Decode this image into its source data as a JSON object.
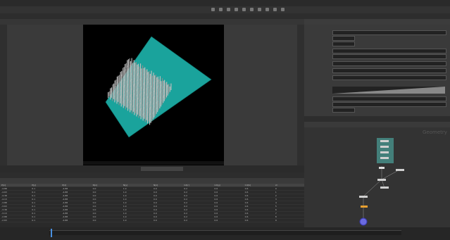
{
  "geometry_spreadsheet": {
    "columns": [
      "P[x]",
      "P[y]",
      "P[z]",
      "N[x]",
      "N[y]",
      "N[z]",
      "Cd[r]",
      "Cd[g]",
      "Cd[b]",
      "id"
    ],
    "rows": [
      [
        "-4.88",
        "0.1",
        "-4.88",
        "0.0",
        "1.0",
        "0.0",
        "0.2",
        "0.6",
        "0.6",
        "0"
      ],
      [
        "-4.63",
        "0.1",
        "-4.88",
        "0.0",
        "1.0",
        "0.0",
        "0.2",
        "0.6",
        "0.6",
        "1"
      ],
      [
        "-4.38",
        "0.1",
        "-4.88",
        "0.0",
        "1.0",
        "0.0",
        "0.2",
        "0.6",
        "0.6",
        "2"
      ],
      [
        "-4.13",
        "0.1",
        "-4.88",
        "0.0",
        "1.0",
        "0.0",
        "0.2",
        "0.6",
        "0.6",
        "3"
      ],
      [
        "-3.88",
        "0.1",
        "-4.88",
        "0.0",
        "1.0",
        "0.0",
        "0.2",
        "0.6",
        "0.6",
        "4"
      ],
      [
        "-3.63",
        "0.1",
        "-4.88",
        "0.0",
        "1.0",
        "0.0",
        "0.2",
        "0.6",
        "0.6",
        "5"
      ],
      [
        "-3.38",
        "0.1",
        "-4.88",
        "0.0",
        "1.0",
        "0.0",
        "0.2",
        "0.6",
        "0.6",
        "6"
      ],
      [
        "-3.13",
        "0.1",
        "-4.88",
        "0.0",
        "1.0",
        "0.0",
        "0.2",
        "0.6",
        "0.6",
        "7"
      ],
      [
        "-2.88",
        "0.1",
        "-4.88",
        "0.0",
        "1.0",
        "0.0",
        "0.2",
        "0.6",
        "0.6",
        "8"
      ],
      [
        "-2.63",
        "0.1",
        "-4.88",
        "0.0",
        "1.0",
        "0.0",
        "0.2",
        "0.6",
        "0.6",
        "9"
      ]
    ]
  },
  "network": {
    "watermark": "Geometry"
  },
  "colors": {
    "ground": "#1aa39c",
    "viewport_bg": "#000000",
    "accent": "#e8a030"
  }
}
